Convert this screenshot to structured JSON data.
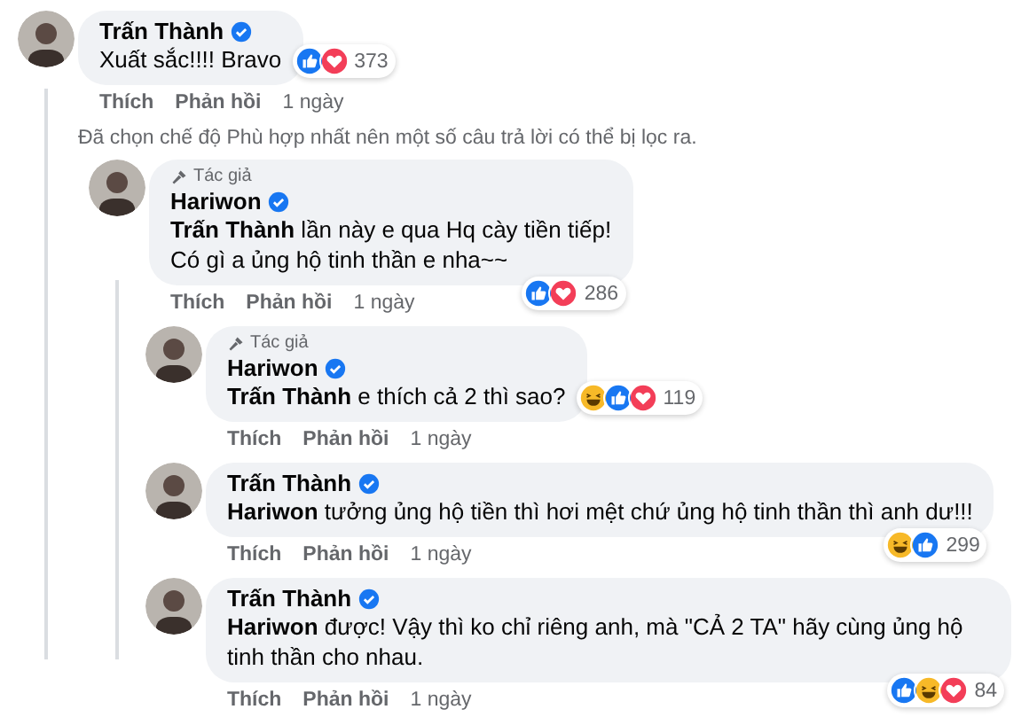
{
  "comments": [
    {
      "author": "Trấn Thành",
      "text": "Xuất sắc!!!! Bravo",
      "reactions": [
        {
          "kind": "like"
        },
        {
          "kind": "love"
        }
      ],
      "reaction_count": "373",
      "actions": [
        "Thích",
        "Phản hồi"
      ],
      "time": "1 ngày",
      "notice": "Đã chọn chế độ Phù hợp nhất nên một số câu trả lời có thể bị lọc ra.",
      "children": [
        {
          "badge": "Tác giả",
          "author": "Hariwon",
          "text": "**Trấn Thành** lần này e qua Hq cày tiền tiếp!\nCó gì a ủng hộ tinh thần e nha~~",
          "reactions": [
            {
              "kind": "like"
            },
            {
              "kind": "love"
            }
          ],
          "reaction_count": "286",
          "actions": [
            "Thích",
            "Phản hồi"
          ],
          "time": "1 ngày",
          "children": [
            {
              "badge": "Tác giả",
              "author": "Hariwon",
              "text": "**Trấn Thành** e thích cả 2 thì sao?",
              "reactions": [
                {
                  "kind": "haha"
                },
                {
                  "kind": "like"
                },
                {
                  "kind": "love"
                }
              ],
              "reaction_count": "119",
              "actions": [
                "Thích",
                "Phản hồi"
              ],
              "time": "1 ngày"
            },
            {
              "author": "Trấn Thành",
              "text": "**Hariwon** tưởng ủng hộ tiền thì hơi mệt chứ ủng hộ tinh thần thì anh dư!!!",
              "reactions": [
                {
                  "kind": "haha"
                },
                {
                  "kind": "like"
                }
              ],
              "reaction_count": "299",
              "actions": [
                "Thích",
                "Phản hồi"
              ],
              "time": "1 ngày"
            },
            {
              "author": "Trấn Thành",
              "text": "**Hariwon** được! Vậy thì ko chỉ riêng anh, mà \"CẢ 2 TA\" hãy cùng ủng hộ tinh thần cho nhau.",
              "reactions": [
                {
                  "kind": "like"
                },
                {
                  "kind": "haha"
                },
                {
                  "kind": "love"
                }
              ],
              "reaction_count": "84",
              "actions": [
                "Thích",
                "Phản hồi"
              ],
              "time": "1 ngày"
            }
          ]
        }
      ]
    }
  ]
}
